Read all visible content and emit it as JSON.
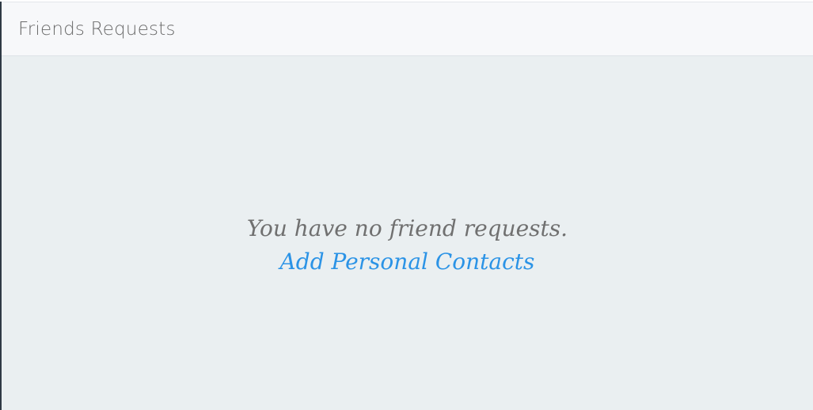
{
  "panel": {
    "title": "Friends Requests"
  },
  "empty_state": {
    "message": "You have no friend requests.",
    "link_label": "Add Personal Contacts"
  },
  "colors": {
    "link": "#2b93e6",
    "message": "#707070",
    "body_background": "#eaeff1",
    "header_background": "#f7f8fa"
  }
}
